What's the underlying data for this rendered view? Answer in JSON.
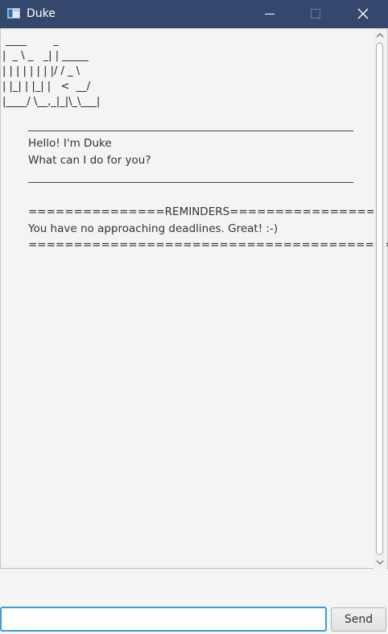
{
  "window": {
    "title": "Duke",
    "icons": {
      "app": "app-window-icon",
      "minimize": "minimize-icon",
      "maximize": "maximize-icon",
      "close": "close-icon"
    }
  },
  "dialog": {
    "logo": " ____        _\n|  _ \\ _   _| | _____\n| | | | | | | |/ / _ \\\n| |_| | |_| |   <  __/\n|____/ \\__,_|_|\\_\\___|",
    "separator_color": "#444444",
    "greeting_line1": "Hello! I'm Duke",
    "greeting_line2": "What can I do for you?",
    "reminders_header": "===============REMINDERS================",
    "reminders_message": "You have no approaching deadlines. Great! :-)",
    "reminders_footer": "========================================"
  },
  "scrollbar": {
    "up_icon": "chevron-up-icon",
    "down_icon": "chevron-down-icon"
  },
  "input": {
    "value": "",
    "placeholder": "",
    "border_color": "#39a0d8"
  },
  "send_button": {
    "label": "Send"
  },
  "colors": {
    "titlebar": "#34486d",
    "background": "#f4f4f4"
  }
}
